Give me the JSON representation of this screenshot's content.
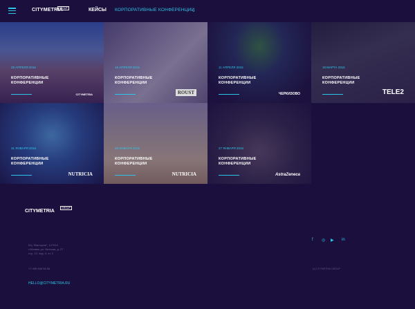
{
  "header": {
    "logo": "CITYMETRIA",
    "logo_badge": "GROUP",
    "nav_cases": "КЕЙСЫ",
    "nav_conf": "КОРПОРАТИВНЫЕ КОНФЕРЕНЦИИ"
  },
  "tiles": [
    {
      "date": "28 АПРЕЛЯ 2016",
      "category": "КОРПОРАТИВНЫЕ КОНФЕРЕНЦИИ",
      "brand": "CITYMETRIA"
    },
    {
      "date": "15 АПРЕЛЯ 2015",
      "category": "КОРПОРАТИВНЫЕ КОНФЕРЕНЦИИ",
      "brand": "ROUST"
    },
    {
      "date": "11 АПРЕЛЯ 2015",
      "category": "КОРПОРАТИВНЫЕ КОНФЕРЕНЦИИ",
      "brand": "ЧЕРКИЗОВО"
    },
    {
      "date": "19 МАРТА 2015",
      "category": "КОРПОРАТИВНЫЕ КОНФЕРЕНЦИИ",
      "brand": "TELE2"
    },
    {
      "date": "31 ЯНВАРЯ 2015",
      "category": "КОРПОРАТИВНЫЕ КОНФЕРЕНЦИИ",
      "brand": "NUTRICIA"
    },
    {
      "date": "28 ЯНВАРЯ 2015",
      "category": "КОРПОРАТИВНЫЕ КОНФЕРЕНЦИИ",
      "brand": "NUTRICIA"
    },
    {
      "date": "27 ЯНВАРЯ 2015",
      "category": "КОРПОРАТИВНЫЕ КОНФЕРЕНЦИИ",
      "brand": "AstraZeneca"
    }
  ],
  "footer": {
    "logo": "CITYMETRIA",
    "logo_badge": "GROUP",
    "address_1": "БЦ \"Фактория\", 127015",
    "address_2": "г.Москва, ул. Вятская, д. 27",
    "address_3": "стр. 13, под. 3, эт. 2",
    "phone": "+7 495 646 55 56",
    "email": "HELLO@CITYMETRIA.RU",
    "copyright": "(c) CITYMETRIA GROUP"
  },
  "social": [
    "f",
    "◎",
    "▶",
    "in"
  ],
  "colors": {
    "accent": "#2ec6e8",
    "background": "#1b0f3d"
  }
}
